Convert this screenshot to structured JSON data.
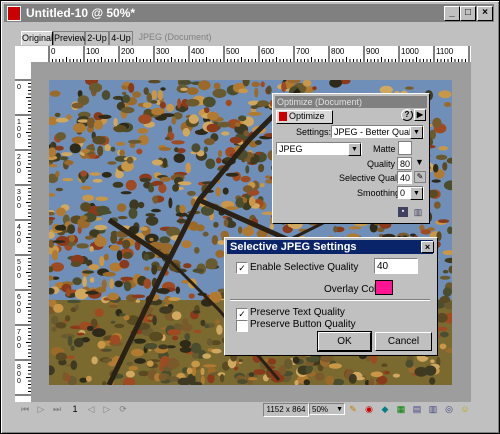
{
  "window": {
    "title": "Untitled-10 @ 50%*",
    "min": "_",
    "max": "□",
    "close": "×"
  },
  "tabs": [
    "Original",
    "Preview",
    "2-Up",
    "4-Up"
  ],
  "tab_note": "JPEG (Document)",
  "ruler_h": [
    "0",
    "100",
    "200",
    "300",
    "400",
    "500",
    "600",
    "700",
    "800",
    "900",
    "1000",
    "1100"
  ],
  "ruler_v": [
    "0",
    "100",
    "200",
    "300",
    "400",
    "500",
    "600",
    "700",
    "800"
  ],
  "optimize": {
    "title": "Optimize (Document)",
    "tab": "Optimize",
    "settings_label": "Settings:",
    "settings_value": "JPEG - Better Quality",
    "format_value": "JPEG",
    "matte_label": "Matte :",
    "quality_label": "Quality :",
    "quality_value": "80",
    "selective_label": "Selective Quality :",
    "selective_value": "40",
    "smoothing_label": "Smoothing :",
    "smoothing_value": "0",
    "help": "?",
    "more": "▶"
  },
  "dialog": {
    "title": "Selective JPEG Settings",
    "close": "×",
    "enable_label": "Enable Selective Quality",
    "enable_checked": "✓",
    "quality_value": "40",
    "overlay_label": "Overlay Color:",
    "overlay_color": "#ff1493",
    "preserve_text": "Preserve Text Quality",
    "preserve_text_checked": "✓",
    "preserve_button": "Preserve Button Quality",
    "ok": "OK",
    "cancel": "Cancel"
  },
  "status": {
    "page": "1",
    "dimensions": "1152 x 864",
    "zoom": "50%"
  },
  "colors": {
    "title_active": "#0a246a",
    "title_inactive": "#808080",
    "overlay": "#ff1493"
  }
}
